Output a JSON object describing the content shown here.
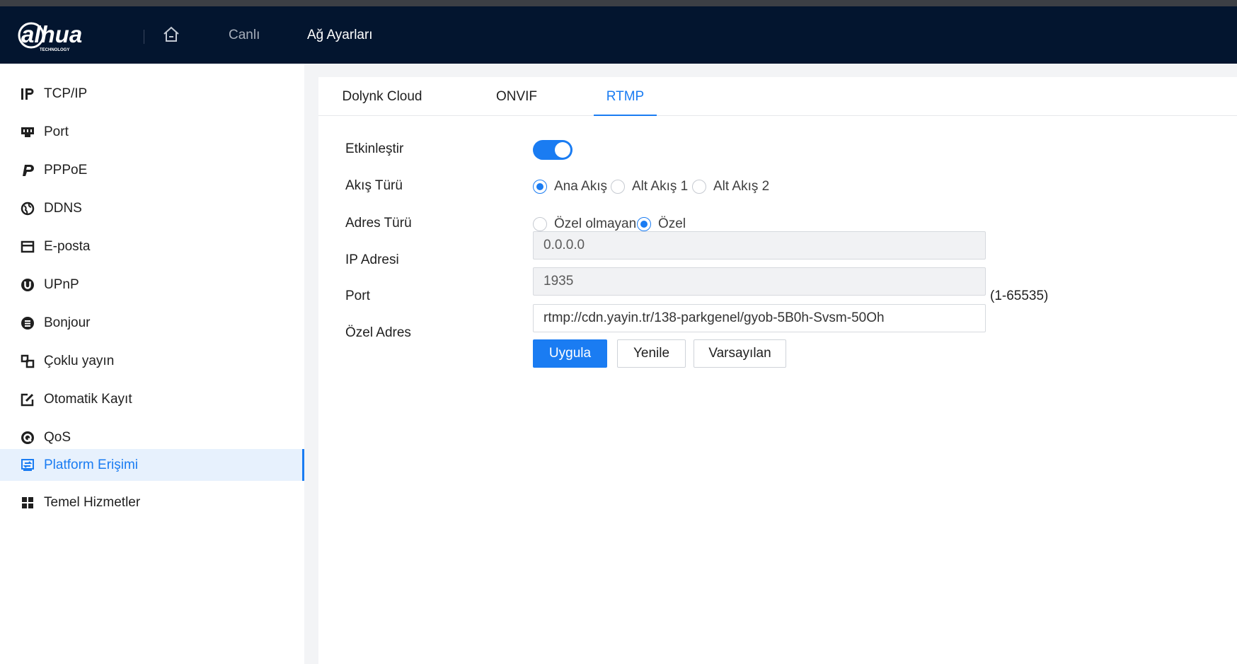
{
  "header": {
    "brand": "alhua",
    "brand_tag": "TECHNOLOGY",
    "nav": [
      {
        "label": "Canlı"
      },
      {
        "label": "Ağ Ayarları"
      }
    ]
  },
  "sidebar": {
    "items": [
      {
        "label": "TCP/IP",
        "icon": "ip-icon"
      },
      {
        "label": "Port",
        "icon": "port-icon"
      },
      {
        "label": "PPPoE",
        "icon": "pppoe-icon"
      },
      {
        "label": "DDNS",
        "icon": "globe-icon"
      },
      {
        "label": "E-posta",
        "icon": "mail-icon"
      },
      {
        "label": "UPnP",
        "icon": "upnp-icon"
      },
      {
        "label": "Bonjour",
        "icon": "bonjour-icon"
      },
      {
        "label": "Çoklu yayın",
        "icon": "multicast-icon"
      },
      {
        "label": "Otomatik Kayıt",
        "icon": "auto-register-icon"
      },
      {
        "label": "QoS",
        "icon": "qos-icon"
      },
      {
        "label": "Platform Erişimi",
        "icon": "platform-access-icon",
        "active": true
      },
      {
        "label": "Temel Hizmetler",
        "icon": "grid-icon"
      }
    ]
  },
  "tabs": [
    {
      "label": "Dolynk Cloud"
    },
    {
      "label": "ONVIF"
    },
    {
      "label": "RTMP",
      "active": true
    }
  ],
  "form": {
    "enable": {
      "label": "Etkinleştir",
      "value": true
    },
    "stream_type": {
      "label": "Akış Türü",
      "options": [
        "Ana Akış",
        "Alt Akış 1",
        "Alt Akış 2"
      ],
      "selected": "Ana Akış"
    },
    "address_type": {
      "label": "Adres Türü",
      "options": [
        "Özel olmayan",
        "Özel"
      ],
      "selected": "Özel"
    },
    "ip": {
      "label": "IP Adresi",
      "value": "0.0.0.0"
    },
    "port": {
      "label": "Port",
      "value": "1935",
      "range": "(1-65535)"
    },
    "custom_address": {
      "label": "Özel Adres",
      "value": "rtmp://cdn.yayin.tr/138-parkgenel/gyob-5B0h-Svsm-50Oh"
    }
  },
  "buttons": {
    "apply": "Uygula",
    "refresh": "Yenile",
    "default": "Varsayılan"
  },
  "colors": {
    "accent": "#1a7cf2",
    "topbar": "#03152f",
    "active_bg": "#e7f1fd"
  }
}
